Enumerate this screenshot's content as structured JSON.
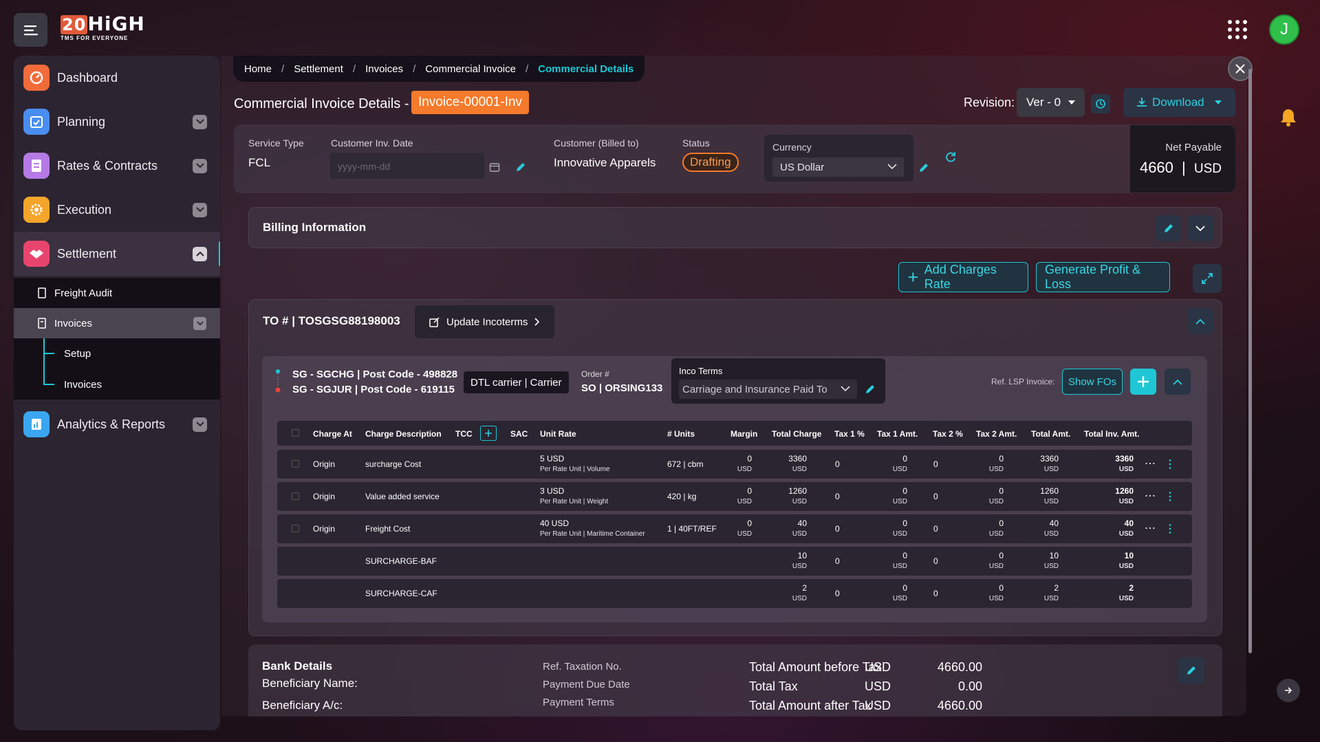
{
  "brand": {
    "name_num": "20",
    "name_text": "HiGH",
    "tagline": "TMS FOR EVERYONE"
  },
  "user": {
    "initial": "J"
  },
  "sidebar": {
    "items": [
      {
        "label": "Dashboard",
        "icon": "dashboard-icon",
        "color": "#f26b3a"
      },
      {
        "label": "Planning",
        "icon": "calendar-check-icon",
        "color": "#4a8df0"
      },
      {
        "label": "Rates & Contracts",
        "icon": "document-icon",
        "color": "#b57ae6"
      },
      {
        "label": "Execution",
        "icon": "gear-icon",
        "color": "#f4a52a"
      },
      {
        "label": "Settlement",
        "icon": "handshake-icon",
        "color": "#e8456e"
      },
      {
        "label": "Analytics & Reports",
        "icon": "report-icon",
        "color": "#3aa6f0"
      }
    ],
    "sub": {
      "freight_audit": "Freight Audit",
      "invoices": "Invoices",
      "setup": "Setup",
      "invoices_child": "Invoices"
    }
  },
  "breadcrumb": [
    "Home",
    "Settlement",
    "Invoices",
    "Commercial Invoice",
    "Commercial Details"
  ],
  "page": {
    "title": "Commercial Invoice Details -",
    "invoice_id": "Invoice-00001-Inv",
    "revision_label": "Revision:",
    "revision": "Ver - 0",
    "download": "Download"
  },
  "header": {
    "service_type_label": "Service Type",
    "service_type": "FCL",
    "cust_date_label": "Customer Inv. Date",
    "cust_date_placeholder": "yyyy-mm-dd",
    "customer_label": "Customer (Billed to)",
    "customer": "Innovative Apparels",
    "status_label": "Status",
    "status": "Drafting",
    "currency_label": "Currency",
    "currency": "US Dollar",
    "net_label": "Net Payable",
    "net_value": "4660",
    "net_currency": "USD"
  },
  "billing": {
    "title": "Billing Information"
  },
  "actions": {
    "add_charges": "Add Charges Rate",
    "generate_pl": "Generate Profit & Loss"
  },
  "to": {
    "title": "TO # | TOSGSG88198003",
    "update_incoterms": "Update Incoterms"
  },
  "route": {
    "origin": "SG - SGCHG | Post Code - 498828",
    "dest": "SG - SGJUR | Post Code - 619115",
    "carrier": "DTL carrier | Carrier",
    "order_label": "Order #",
    "order": "SO | ORSING133",
    "inco_label": "Inco Terms",
    "inco": "Carriage and Insurance Paid To",
    "ref_lsp": "Ref. LSP Invoice:",
    "show_fos": "Show FOs"
  },
  "table": {
    "headers": [
      "Charge At",
      "Charge Description",
      "TCC",
      "SAC",
      "Unit Rate",
      "# Units",
      "Margin",
      "Total Charge",
      "Tax 1 %",
      "Tax 1 Amt.",
      "Tax 2 %",
      "Tax 2 Amt.",
      "Total Amt.",
      "Total Inv. Amt."
    ],
    "rows": [
      {
        "charge_at": "Origin",
        "desc": "surcharge Cost",
        "unit_rate": "5 USD",
        "unit_basis": "Per Rate Unit | Volume",
        "units": "672 | cbm",
        "margin": "0",
        "total_charge": "3360",
        "tax1p": "0",
        "tax1a": "0",
        "tax2p": "0",
        "tax2a": "0",
        "total_amt": "3360",
        "total_inv": "3360",
        "cur": "USD"
      },
      {
        "charge_at": "Origin",
        "desc": "Value added service",
        "unit_rate": "3 USD",
        "unit_basis": "Per Rate Unit | Weight",
        "units": "420 | kg",
        "margin": "0",
        "total_charge": "1260",
        "tax1p": "0",
        "tax1a": "0",
        "tax2p": "0",
        "tax2a": "0",
        "total_amt": "1260",
        "total_inv": "1260",
        "cur": "USD"
      },
      {
        "charge_at": "Origin",
        "desc": "Freight Cost",
        "unit_rate": "40 USD",
        "unit_basis": "Per Rate Unit | Maritime Container",
        "units": "1 | 40FT/REF",
        "margin": "0",
        "total_charge": "40",
        "tax1p": "0",
        "tax1a": "0",
        "tax2p": "0",
        "tax2a": "0",
        "total_amt": "40",
        "total_inv": "40",
        "cur": "USD"
      },
      {
        "charge_at": "",
        "desc": "SURCHARGE-BAF",
        "unit_rate": "",
        "unit_basis": "",
        "units": "",
        "margin": "",
        "total_charge": "10",
        "tax1p": "0",
        "tax1a": "0",
        "tax2p": "0",
        "tax2a": "0",
        "total_amt": "10",
        "total_inv": "10",
        "cur": "USD"
      },
      {
        "charge_at": "",
        "desc": "SURCHARGE-CAF",
        "unit_rate": "",
        "unit_basis": "",
        "units": "",
        "margin": "",
        "total_charge": "2",
        "tax1p": "0",
        "tax1a": "0",
        "tax2p": "0",
        "tax2a": "0",
        "total_amt": "2",
        "total_inv": "2",
        "cur": "USD"
      }
    ]
  },
  "bank": {
    "title": "Bank Details",
    "beneficiary_name": "Beneficiary Name:",
    "beneficiary_ac": "Beneficiary A/c:",
    "ref_tax": "Ref. Taxation No.",
    "due_date": "Payment Due Date",
    "terms": "Payment Terms",
    "totals": [
      {
        "label": "Total Amount before Tax",
        "cur": "USD",
        "value": "4660.00"
      },
      {
        "label": "Total Tax",
        "cur": "USD",
        "value": "0.00"
      },
      {
        "label": "Total Amount after Tax",
        "cur": "USD",
        "value": "4660.00"
      }
    ]
  },
  "colors": {
    "accent": "#19c9d6",
    "status": "#f57a2b"
  }
}
